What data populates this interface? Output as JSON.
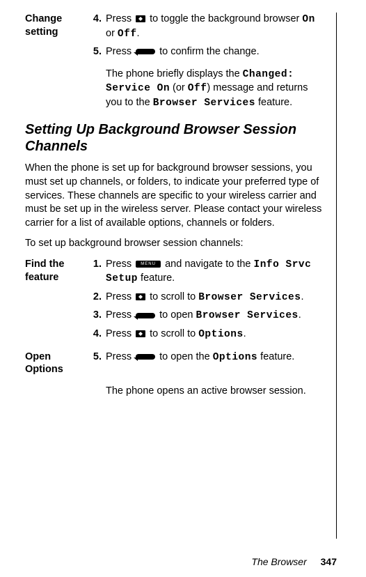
{
  "sec1": {
    "label": "Change\nsetting",
    "step4": {
      "num": "4.",
      "pre": "Press ",
      "mid": " to toggle the background browser ",
      "mono1": "On",
      "or": " or ",
      "mono2": "Off",
      "end": "."
    },
    "step5": {
      "num": "5.",
      "pre": "Press ",
      "post": " to confirm the change."
    },
    "result": {
      "t1": "The phone briefly displays the ",
      "m1": "Changed: Service On",
      "t2": " (or ",
      "m2": "Off",
      "t3": ") message and returns you to the ",
      "m3": "Browser Services",
      "t4": " feature."
    }
  },
  "heading": "Setting Up Background Browser Session Channels",
  "para1": "When the phone is set up for background browser sessions, you must set up channels, or folders, to indicate your preferred type of services. These channels are specific to your wireless carrier and must be set up in the wireless server. Please contact your wireless carrier for a list of available options, channels or folders.",
  "para2": "To set up background browser session channels:",
  "sec2": {
    "label": "Find the\nfeature",
    "step1": {
      "num": "1.",
      "pre": "Press ",
      "mid": " and navigate to the ",
      "mono": "Info Srvc Setup",
      "end": " feature."
    },
    "step2": {
      "num": "2.",
      "pre": "Press ",
      "mid": " to scroll to ",
      "mono": "Browser Services",
      "end": "."
    },
    "step3": {
      "num": "3.",
      "pre": "Press ",
      "mid": " to open ",
      "mono": "Browser Services",
      "end": "."
    },
    "step4": {
      "num": "4.",
      "pre": "Press ",
      "mid": " to scroll to ",
      "mono": "Options",
      "end": "."
    }
  },
  "sec3": {
    "label": "Open\nOptions",
    "step5": {
      "num": "5.",
      "pre": "Press ",
      "mid": " to open the ",
      "mono": "Options",
      "end": " feature."
    },
    "result": "The phone opens an active browser session."
  },
  "menu_label": "MENU",
  "footer": {
    "title": "The Browser",
    "page": "347"
  }
}
